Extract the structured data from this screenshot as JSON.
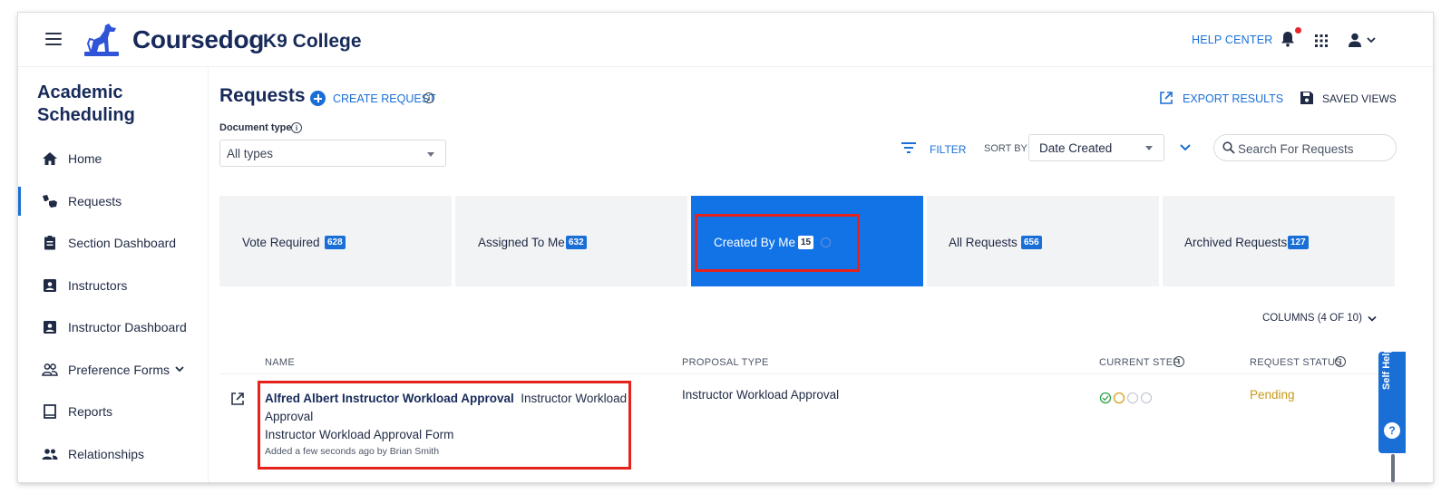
{
  "header": {
    "brand": "Coursedog",
    "college": "K9 College",
    "help_center": "HELP CENTER"
  },
  "sidebar": {
    "title": "Academic Scheduling",
    "items": [
      {
        "label": "Home",
        "icon": "home-icon"
      },
      {
        "label": "Requests",
        "icon": "requests-icon",
        "active": true
      },
      {
        "label": "Section Dashboard",
        "icon": "clipboard-icon"
      },
      {
        "label": "Instructors",
        "icon": "contact-card-icon"
      },
      {
        "label": "Instructor Dashboard",
        "icon": "contact-card-icon"
      },
      {
        "label": "Preference Forms",
        "icon": "people-icon"
      },
      {
        "label": "Reports",
        "icon": "book-icon"
      },
      {
        "label": "Relationships",
        "icon": "group-icon"
      }
    ]
  },
  "main": {
    "title": "Requests",
    "create_request": "CREATE REQUEST",
    "export_results": "EXPORT RESULTS",
    "saved_views": "SAVED VIEWS",
    "document_type_label": "Document type",
    "document_type_value": "All types",
    "filter": "FILTER",
    "sort_by_label": "SORT BY",
    "sort_by_value": "Date Created",
    "search_placeholder": "Search For Requests",
    "columns_toggle": "COLUMNS (4 OF 10)"
  },
  "tabs": [
    {
      "label": "Vote Required",
      "count": "628"
    },
    {
      "label": "Assigned To Me",
      "count": "632"
    },
    {
      "label": "Created By Me",
      "count": "15",
      "active": true
    },
    {
      "label": "All Requests",
      "count": "656"
    },
    {
      "label": "Archived Requests",
      "count": "127"
    }
  ],
  "table": {
    "headers": {
      "name": "NAME",
      "proposal_type": "PROPOSAL TYPE",
      "current_step": "CURRENT STEP",
      "request_status": "REQUEST STATUS"
    },
    "rows": [
      {
        "name_bold": "Alfred Albert Instructor Workload Approval",
        "name_rest": "Instructor Workload Approval",
        "form": "Instructor Workload Approval Form",
        "meta": "Added a few seconds ago by Brian Smith",
        "proposal_type": "Instructor Workload Approval",
        "steps": [
          "complete",
          "current",
          "pending",
          "pending"
        ],
        "status": "Pending"
      }
    ]
  },
  "self_help": {
    "label": "Self Help",
    "icon": "question-icon"
  },
  "colors": {
    "accent": "#1a6fd6",
    "active_tab": "#1173e6",
    "brand_text": "#172a5a",
    "highlight": "#e5221c",
    "status_pending": "#c79a1a",
    "step_complete": "#2ea44f",
    "step_current": "#d9a21b"
  }
}
